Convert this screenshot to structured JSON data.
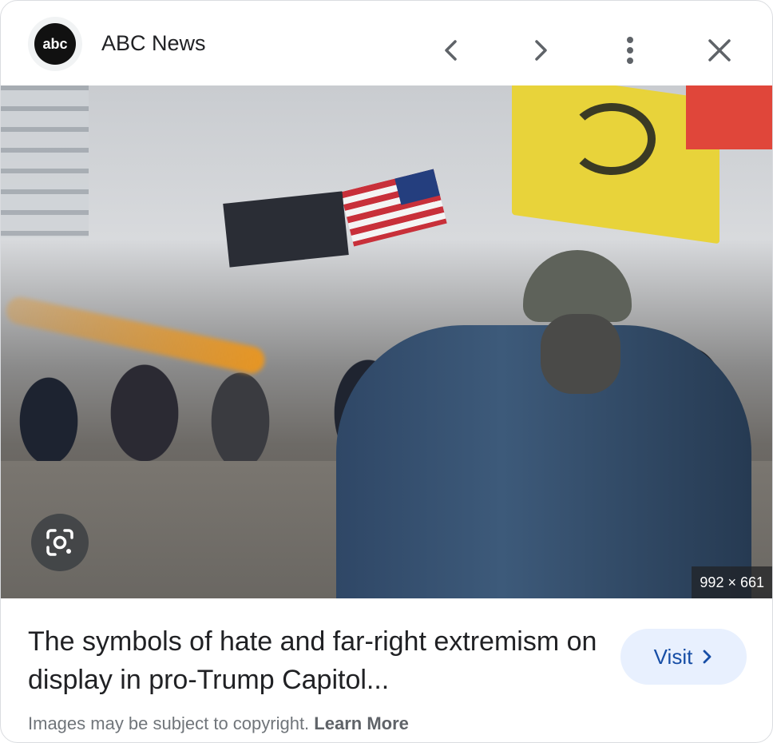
{
  "header": {
    "logo_text": "abc",
    "source": "ABC News"
  },
  "image": {
    "dimensions": "992 × 661"
  },
  "result": {
    "title": "The symbols of hate and far-right extremism on display in pro-Trump Capitol...",
    "visit_label": "Visit"
  },
  "footer": {
    "copyright": "Images may be subject to copyright.",
    "learn_more": "Learn More"
  },
  "icons": {
    "prev": "chevron-left-icon",
    "next": "chevron-right-icon",
    "more": "more-vert-icon",
    "close": "close-icon",
    "lens": "google-lens-icon",
    "visit_arrow": "chevron-right-icon"
  },
  "colors": {
    "visit_bg": "#e8f0fe",
    "visit_text": "#174ea6"
  }
}
